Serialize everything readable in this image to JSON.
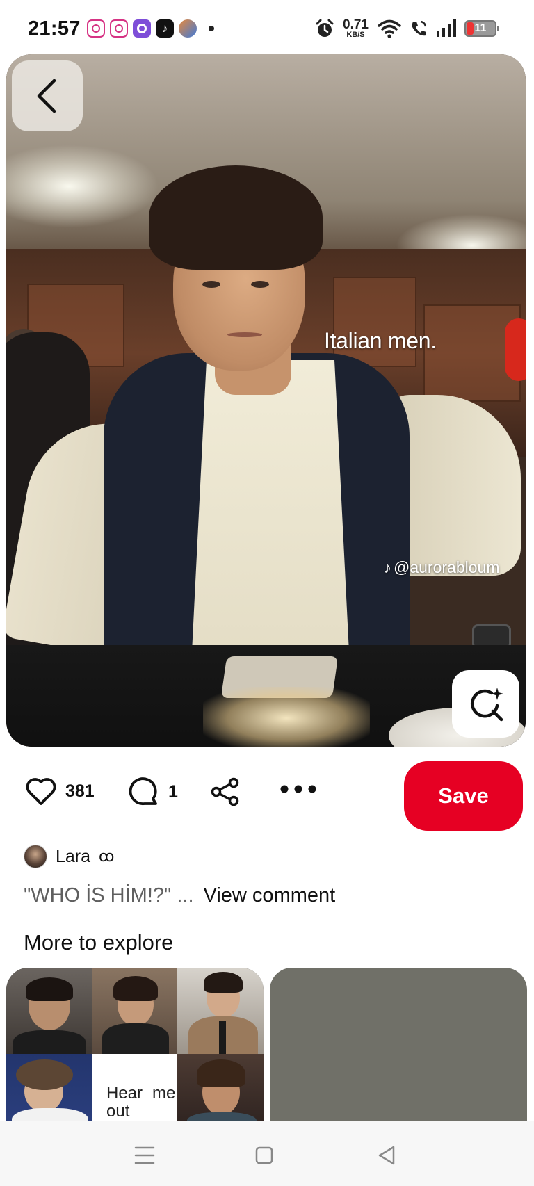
{
  "status_bar": {
    "time": "21:57",
    "app_icons": [
      "instagram-icon",
      "instagram-icon",
      "threads-icon",
      "tiktok-icon",
      "game-icon"
    ],
    "net_speed_value": "0.71",
    "net_speed_unit": "KB/S",
    "battery": "11",
    "battery_level": 0.11
  },
  "pin": {
    "image_caption": "Italian men.",
    "image_watermark": "@aurorabloum"
  },
  "actions": {
    "likes": "381",
    "comments": "1",
    "save_label": "Save"
  },
  "comment_preview": {
    "author": "Lara",
    "author_badge": "ꝏ",
    "text": "\"WHO İS HİM!?\" ...",
    "view_label": "View comment"
  },
  "explore": {
    "title": "More to explore",
    "tile_text_line1_a": "Hear",
    "tile_text_line1_b": "me",
    "tile_text_line2": "out"
  },
  "colors": {
    "accent": "#e60023",
    "muted_text": "#5f5f5f",
    "card_gray": "#707068"
  }
}
